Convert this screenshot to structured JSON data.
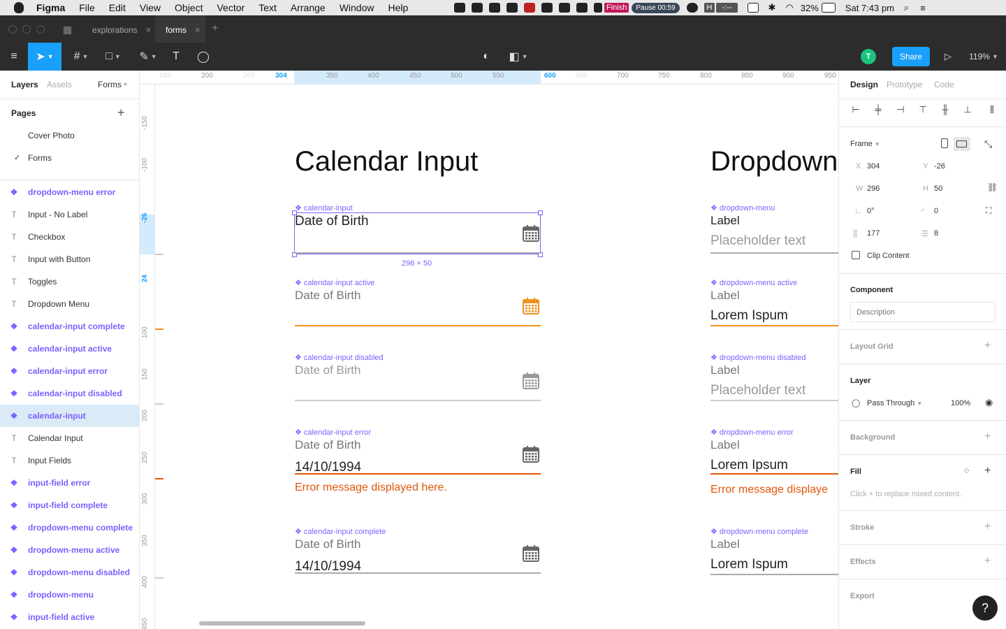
{
  "menubar": {
    "app": "Figma",
    "items": [
      "File",
      "Edit",
      "View",
      "Object",
      "Vector",
      "Text",
      "Arrange",
      "Window",
      "Help"
    ],
    "finish": "Finish",
    "pause": "Pause 00:59",
    "h_label": "H",
    "dash": "-:--",
    "battery": "32%",
    "clock": "Sat 7:43 pm"
  },
  "tabs": {
    "explorations": "explorations",
    "forms": "forms",
    "close": "×",
    "add": "+"
  },
  "toolbar": {
    "share": "Share",
    "avatar": "T",
    "zoom": "119%",
    "text_tool": "T"
  },
  "left_panel": {
    "tabs": [
      "Layers",
      "Assets"
    ],
    "page_select": "Forms",
    "pages_header": "Pages",
    "add": "+",
    "pages": [
      "Cover Photo",
      "Forms"
    ],
    "check": "✓",
    "layers": [
      {
        "name": "dropdown-menu error",
        "type": "component"
      },
      {
        "name": "Input - No Label",
        "type": "text"
      },
      {
        "name": "Checkbox",
        "type": "text"
      },
      {
        "name": "Input with Button",
        "type": "text"
      },
      {
        "name": "Toggles",
        "type": "text"
      },
      {
        "name": "Dropdown Menu",
        "type": "text"
      },
      {
        "name": "calendar-input complete",
        "type": "component"
      },
      {
        "name": "calendar-input active",
        "type": "component"
      },
      {
        "name": "calendar-input error",
        "type": "component"
      },
      {
        "name": "calendar-input disabled",
        "type": "component"
      },
      {
        "name": "calendar-input",
        "type": "component",
        "selected": true
      },
      {
        "name": "Calendar Input",
        "type": "text"
      },
      {
        "name": "Input Fields",
        "type": "text"
      },
      {
        "name": "input-field error",
        "type": "component"
      },
      {
        "name": "input-field complete",
        "type": "component"
      },
      {
        "name": "dropdown-menu complete",
        "type": "component"
      },
      {
        "name": "dropdown-menu active",
        "type": "component"
      },
      {
        "name": "dropdown-menu disabled",
        "type": "component"
      },
      {
        "name": "dropdown-menu",
        "type": "component"
      },
      {
        "name": "input-field active",
        "type": "component"
      }
    ]
  },
  "rulers": {
    "top": [
      "150",
      "200",
      "250",
      "304",
      "350",
      "400",
      "450",
      "500",
      "550",
      "600",
      "650",
      "700",
      "750",
      "800",
      "850",
      "900",
      "950"
    ],
    "left": [
      "-150",
      "-100",
      "-26",
      "24",
      "100",
      "150",
      "200",
      "250",
      "300",
      "350",
      "400",
      "450"
    ]
  },
  "canvas": {
    "calendar_title": "Calendar Input",
    "dropdown_title": "Dropdown",
    "selection_size": "296 × 50",
    "calendar": [
      {
        "tag": "❖ calendar-input",
        "label": "Date of Birth",
        "value": ""
      },
      {
        "tag": "❖ calendar-input active",
        "label": "Date of Birth",
        "value": ""
      },
      {
        "tag": "❖ calendar-input disabled",
        "label": "Date of Birth",
        "value": ""
      },
      {
        "tag": "❖ calendar-input error",
        "label": "Date of Birth",
        "value": "14/10/1994",
        "error": "Error message displayed here."
      },
      {
        "tag": "❖ calendar-input complete",
        "label": "Date of Birth",
        "value": "14/10/1994"
      }
    ],
    "dropdown": [
      {
        "tag": "❖ dropdown-menu",
        "label": "Label",
        "value": "Placeholder text"
      },
      {
        "tag": "❖ dropdown-menu active",
        "label": "Label",
        "value": "Lorem Ispum"
      },
      {
        "tag": "❖ dropdown-menu disabled",
        "label": "Label",
        "value": "Placeholder text"
      },
      {
        "tag": "❖ dropdown-menu error",
        "label": "Label",
        "value": "Lorem Ipsum",
        "error": "Error message displaye"
      },
      {
        "tag": "❖ dropdown-menu complete",
        "label": "Label",
        "value": "Lorem Ispum"
      }
    ]
  },
  "right_panel": {
    "tabs": [
      "Design",
      "Prototype",
      "Code"
    ],
    "frame": "Frame",
    "x_label": "X",
    "x": "304",
    "y_label": "Y",
    "y": "-26",
    "w_label": "W",
    "w": "296",
    "h_label": "H",
    "h": "50",
    "rotation": "0°",
    "radius": "0",
    "spacing_a": "177",
    "spacing_b": "8",
    "clip": "Clip Content",
    "component": "Component",
    "description_placeholder": "Description",
    "layout_grid": "Layout Grid",
    "layer": "Layer",
    "blend": "Pass Through",
    "opacity": "100%",
    "background": "Background",
    "fill": "Fill",
    "fill_hint": "Click + to replace mixed content.",
    "stroke": "Stroke",
    "effects": "Effects",
    "export": "Export",
    "add": "+",
    "help": "?"
  },
  "colors": {
    "accent": "#18a0fb",
    "component": "#7b61ff",
    "active": "#f0901e",
    "error": "#e2560a"
  }
}
